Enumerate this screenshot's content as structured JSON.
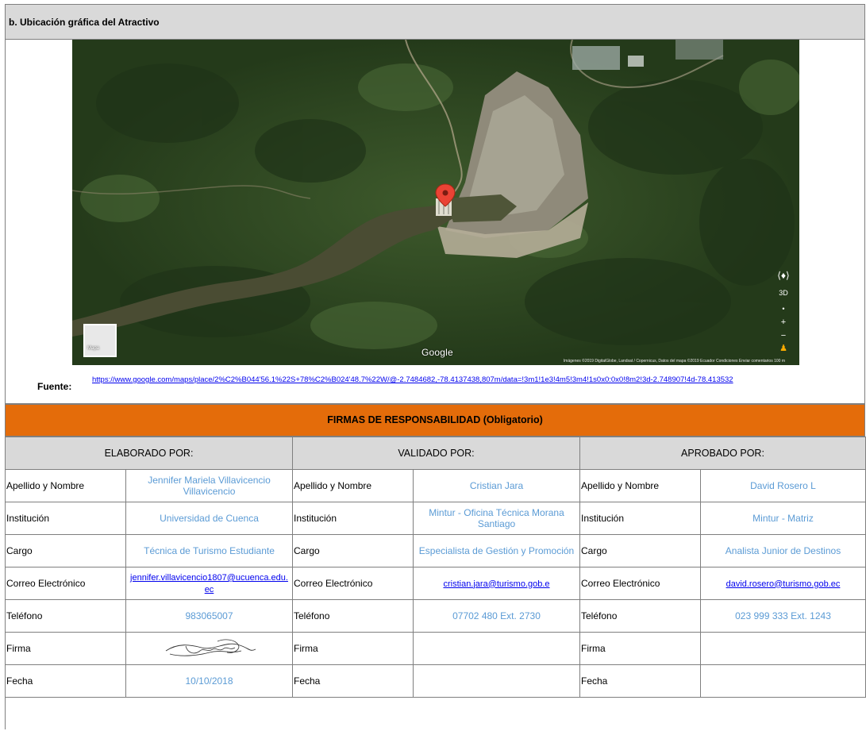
{
  "section": {
    "title": "b. Ubicación gráfica del Atractivo"
  },
  "map": {
    "google_logo": "Google",
    "type_toggle": "Mapa",
    "controls": [
      "3D",
      "+",
      "−"
    ],
    "attribution": "Imágenes ©2019 DigitalGlobe, Landsat / Copernicus, Datos del mapa ©2019   Ecuador   Condiciones   Enviar comentarios   100 m",
    "pin_color": "#ea4335"
  },
  "fuente": {
    "label": "Fuente:",
    "url": "https://www.google.com/maps/place/2%C2%B044'56.1%22S+78%C2%B024'48.7%22W/@-2.7484682,-78.4137438,807m/data=!3m1!1e3!4m5!3m4!1s0x0:0x0!8m2!3d-2.748907!4d-78.413532"
  },
  "firmas": {
    "title": "FIRMAS DE RESPONSABILIDAD (Obligatorio)",
    "accent": "#e46c0a"
  },
  "columns": [
    {
      "heading": "ELABORADO POR:",
      "nombre": "Jennifer Mariela Villavicencio Villavicencio",
      "institucion": "Universidad de Cuenca",
      "cargo": "Técnica de Turismo Estudiante",
      "correo": "jennifer.villavicencio1807@ucuenca.edu.ec",
      "telefono": "983065007",
      "firma": "",
      "fecha": "10/10/2018"
    },
    {
      "heading": "VALIDADO  POR:",
      "nombre": "Cristian Jara",
      "institucion": "Mintur - Oficina Técnica Morana Santiago",
      "cargo": "Especialista de Gestión y Promoción",
      "correo": "cristian.jara@turismo.gob.e",
      "telefono": "07702 480 Ext. 2730",
      "firma": "",
      "fecha": ""
    },
    {
      "heading": "APROBADO POR:",
      "nombre": "David Rosero L",
      "institucion": "Mintur - Matriz",
      "cargo": "Analista Junior de Destinos",
      "correo": "david.rosero@turismo.gob.ec",
      "telefono": "023 999 333 Ext. 1243",
      "firma": "",
      "fecha": ""
    }
  ],
  "labels": {
    "nombre": "Apellido y Nombre",
    "institucion": "Institución",
    "cargo": "Cargo",
    "correo": "Correo Electrónico",
    "telefono": "Teléfono",
    "firma": "Firma",
    "fecha": "Fecha"
  }
}
